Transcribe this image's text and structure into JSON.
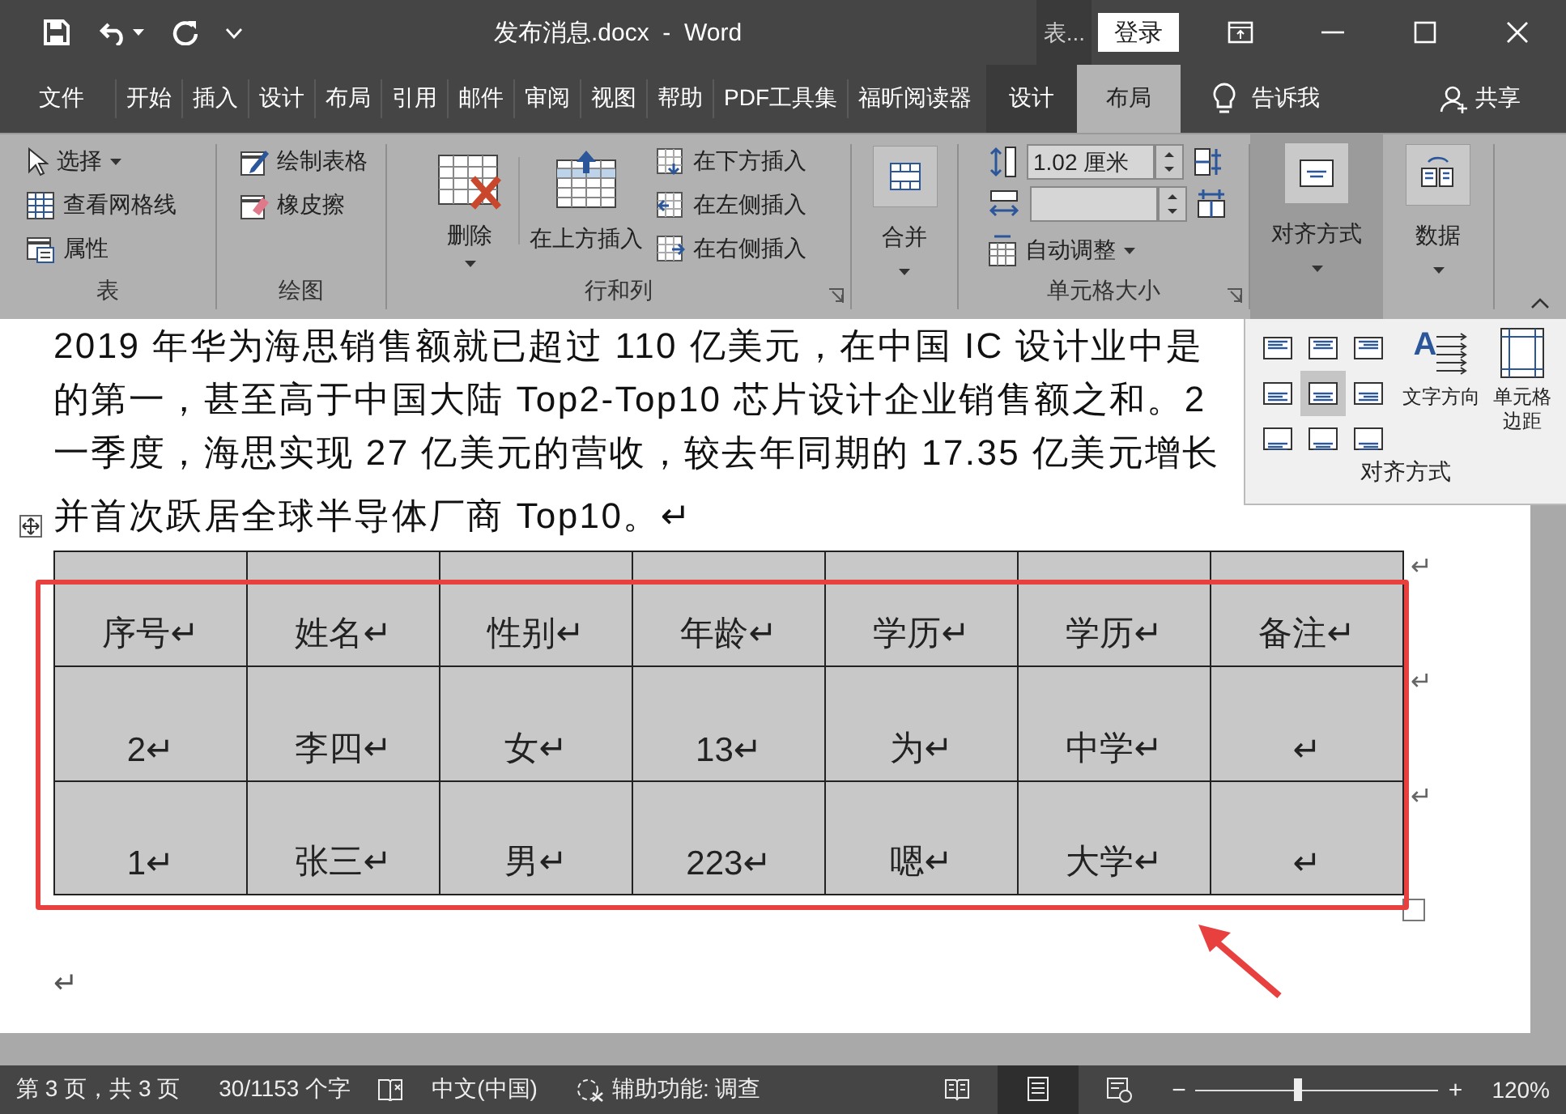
{
  "title_bar": {
    "title": "发布消息.docx  -  Word",
    "context_label": "表...",
    "sign_in": "登录"
  },
  "ribbon_tabs": [
    {
      "label": "文件",
      "kind": "normal",
      "selected": false
    },
    {
      "label": "开始",
      "kind": "normal",
      "selected": false
    },
    {
      "label": "插入",
      "kind": "normal",
      "selected": false
    },
    {
      "label": "设计",
      "kind": "normal",
      "selected": false
    },
    {
      "label": "布局",
      "kind": "normal",
      "selected": false
    },
    {
      "label": "引用",
      "kind": "normal",
      "selected": false
    },
    {
      "label": "邮件",
      "kind": "normal",
      "selected": false
    },
    {
      "label": "审阅",
      "kind": "normal",
      "selected": false
    },
    {
      "label": "视图",
      "kind": "normal",
      "selected": false
    },
    {
      "label": "帮助",
      "kind": "normal",
      "selected": false
    },
    {
      "label": "PDF工具集",
      "kind": "normal",
      "selected": false
    },
    {
      "label": "福昕阅读器",
      "kind": "normal",
      "selected": false
    },
    {
      "label": "设计",
      "kind": "context",
      "selected": false
    },
    {
      "label": "布局",
      "kind": "context",
      "selected": true
    }
  ],
  "tell_me": "告诉我",
  "share": "共享",
  "ribbon": {
    "table_group": {
      "label": "表",
      "select": "选择",
      "gridlines": "查看网格线",
      "properties": "属性"
    },
    "draw_group": {
      "label": "绘图",
      "draw_table": "绘制表格",
      "eraser": "橡皮擦"
    },
    "rows_columns_group": {
      "label": "行和列",
      "delete": "删除",
      "insert_above": "在上方插入",
      "insert_below": "在下方插入",
      "insert_left": "在左侧插入",
      "insert_right": "在右侧插入"
    },
    "merge": "合并",
    "cell_size_group": {
      "label": "单元格大小",
      "height": "1.02 厘米",
      "autofit": "自动调整"
    },
    "alignment": {
      "label": "对齐方式",
      "expanded": true
    },
    "data": "数据"
  },
  "alignment_panel": {
    "buttons": [
      {
        "selected": false
      },
      {
        "selected": false
      },
      {
        "selected": false
      },
      {
        "selected": false
      },
      {
        "selected": true
      },
      {
        "selected": false
      },
      {
        "selected": false
      },
      {
        "selected": false
      },
      {
        "selected": false
      }
    ],
    "text_direction_glyph": "A",
    "text_direction": "文字方向",
    "cell_margins": [
      "单元格",
      "边距"
    ],
    "label": "对齐方式"
  },
  "document": {
    "lines": [
      "2019 年华为海思销售额就已超过 110 亿美元，在中国 IC 设计业中是",
      "的第一，甚至高于中国大陆 Top2-Top10 芯片设计企业销售额之和。2",
      "一季度，海思实现 27 亿美元的营收，较去年同期的 17.35 亿美元增长",
      "并首次跃居全球半导体厂商 Top10。↵"
    ],
    "table": [
      {
        "cells": [
          "序号↵",
          "姓名↵",
          "性别↵",
          "年龄↵",
          "学历↵",
          "学历↵",
          "备注↵"
        ],
        "end_mark": "↵"
      },
      {
        "cells": [
          "2↵",
          "李四↵",
          "女↵",
          "13↵",
          "为↵",
          "中学↵",
          "↵"
        ],
        "end_mark": "↵"
      },
      {
        "cells": [
          "1↵",
          "张三↵",
          "男↵",
          "223↵",
          "嗯↵",
          "大学↵",
          "↵"
        ],
        "end_mark": "↵"
      }
    ],
    "end_mark": "↵"
  },
  "status_bar": {
    "items": [
      "第 3 页，共 3 页",
      "30/1153 个字"
    ],
    "language": "中文(中国)",
    "accessibility": "辅助功能: 调查",
    "views": [
      {
        "kind": "read",
        "selected": false
      },
      {
        "kind": "print",
        "selected": true
      },
      {
        "kind": "web",
        "selected": false
      }
    ],
    "zoom": {
      "minus": "−",
      "plus": "+",
      "level": 0.42,
      "reading": "120%"
    }
  }
}
